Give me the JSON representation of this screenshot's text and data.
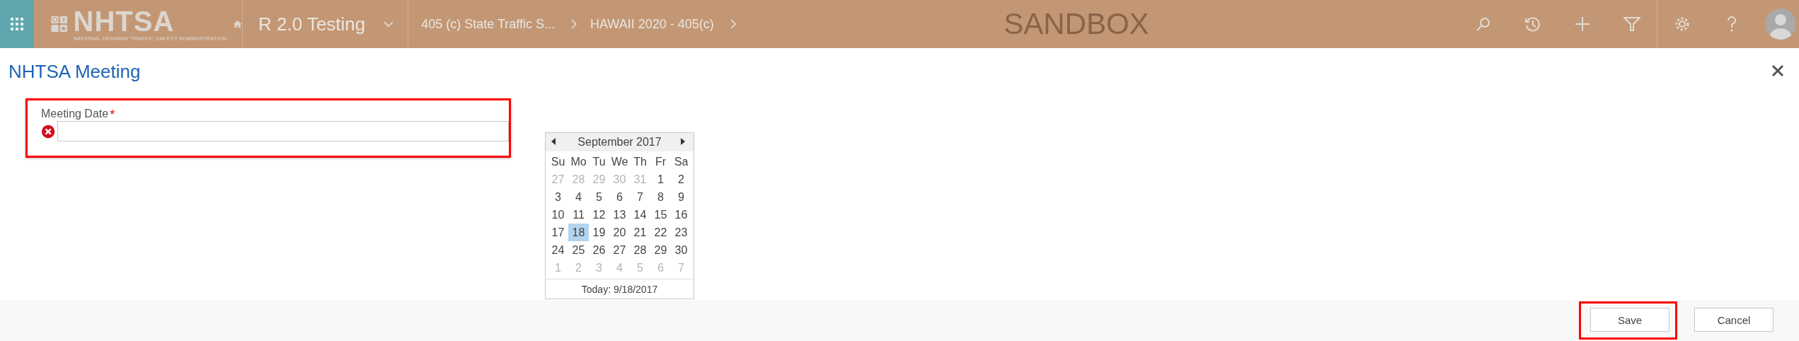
{
  "top_bar": {
    "logo": {
      "title": "NHTSA",
      "subtitle": "NATIONAL HIGHWAY TRAFFIC SAFETY ADMINISTRATION"
    },
    "app_name": "R 2.0 Testing",
    "breadcrumbs": [
      "405 (c) State Traffic S...",
      "HAWAII 2020 - 405(c)"
    ],
    "environment": "SANDBOX"
  },
  "dialog": {
    "title": "NHTSA Meeting",
    "field": {
      "label": "Meeting Date",
      "required": true,
      "required_mark": "*",
      "error": true,
      "highlighted": true
    },
    "calendar": {
      "month": "September 2017",
      "weekdays": [
        "Su",
        "Mo",
        "Tu",
        "We",
        "Th",
        "Fr",
        "Sa"
      ],
      "weeks": [
        [
          {
            "day": "27",
            "muted": true,
            "selected": false
          },
          {
            "day": "28",
            "muted": true,
            "selected": false
          },
          {
            "day": "29",
            "muted": true,
            "selected": false
          },
          {
            "day": "30",
            "muted": true,
            "selected": false
          },
          {
            "day": "31",
            "muted": true,
            "selected": false
          },
          {
            "day": "1",
            "muted": false,
            "selected": false
          },
          {
            "day": "2",
            "muted": false,
            "selected": false
          }
        ],
        [
          {
            "day": "3",
            "muted": false,
            "selected": false
          },
          {
            "day": "4",
            "muted": false,
            "selected": false
          },
          {
            "day": "5",
            "muted": false,
            "selected": false
          },
          {
            "day": "6",
            "muted": false,
            "selected": false
          },
          {
            "day": "7",
            "muted": false,
            "selected": false
          },
          {
            "day": "8",
            "muted": false,
            "selected": false
          },
          {
            "day": "9",
            "muted": false,
            "selected": false
          }
        ],
        [
          {
            "day": "10",
            "muted": false,
            "selected": false
          },
          {
            "day": "11",
            "muted": false,
            "selected": false
          },
          {
            "day": "12",
            "muted": false,
            "selected": false
          },
          {
            "day": "13",
            "muted": false,
            "selected": false
          },
          {
            "day": "14",
            "muted": false,
            "selected": false
          },
          {
            "day": "15",
            "muted": false,
            "selected": false
          },
          {
            "day": "16",
            "muted": false,
            "selected": false
          }
        ],
        [
          {
            "day": "17",
            "muted": false,
            "selected": false
          },
          {
            "day": "18",
            "muted": false,
            "selected": true
          },
          {
            "day": "19",
            "muted": false,
            "selected": false
          },
          {
            "day": "20",
            "muted": false,
            "selected": false
          },
          {
            "day": "21",
            "muted": false,
            "selected": false
          },
          {
            "day": "22",
            "muted": false,
            "selected": false
          },
          {
            "day": "23",
            "muted": false,
            "selected": false
          }
        ],
        [
          {
            "day": "24",
            "muted": false,
            "selected": false
          },
          {
            "day": "25",
            "muted": false,
            "selected": false
          },
          {
            "day": "26",
            "muted": false,
            "selected": false
          },
          {
            "day": "27",
            "muted": false,
            "selected": false
          },
          {
            "day": "28",
            "muted": false,
            "selected": false
          },
          {
            "day": "29",
            "muted": false,
            "selected": false
          },
          {
            "day": "30",
            "muted": false,
            "selected": false
          }
        ],
        [
          {
            "day": "1",
            "muted": true,
            "selected": false
          },
          {
            "day": "2",
            "muted": true,
            "selected": false
          },
          {
            "day": "3",
            "muted": true,
            "selected": false
          },
          {
            "day": "4",
            "muted": true,
            "selected": false
          },
          {
            "day": "5",
            "muted": true,
            "selected": false
          },
          {
            "day": "6",
            "muted": true,
            "selected": false
          },
          {
            "day": "7",
            "muted": true,
            "selected": false
          }
        ]
      ],
      "today": "Today: 9/18/2017"
    },
    "buttons": [
      {
        "label": "Save",
        "highlighted": true
      },
      {
        "label": "Cancel",
        "highlighted": false
      }
    ]
  }
}
